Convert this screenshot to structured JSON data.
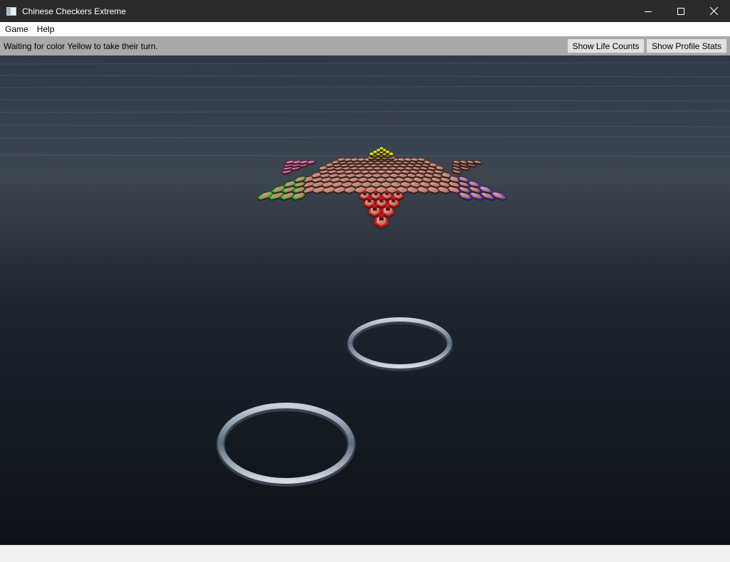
{
  "window": {
    "title": "Chinese Checkers Extreme"
  },
  "menu": {
    "items": [
      "Game",
      "Help"
    ]
  },
  "status": {
    "message": "Waiting for color Yellow to take their turn.",
    "show_life_counts": "Show Life Counts",
    "show_profile_stats": "Show Profile Stats"
  },
  "game": {
    "current_turn": "Yellow",
    "player_colors": {
      "Red": "#c8181c",
      "Green": "#38c030",
      "Blue": "#5a46e6",
      "Magenta": "#e63ce6",
      "Yellow": "#ecec10",
      "Brown": "#7a5a50"
    },
    "water_color": "#2a3440"
  }
}
